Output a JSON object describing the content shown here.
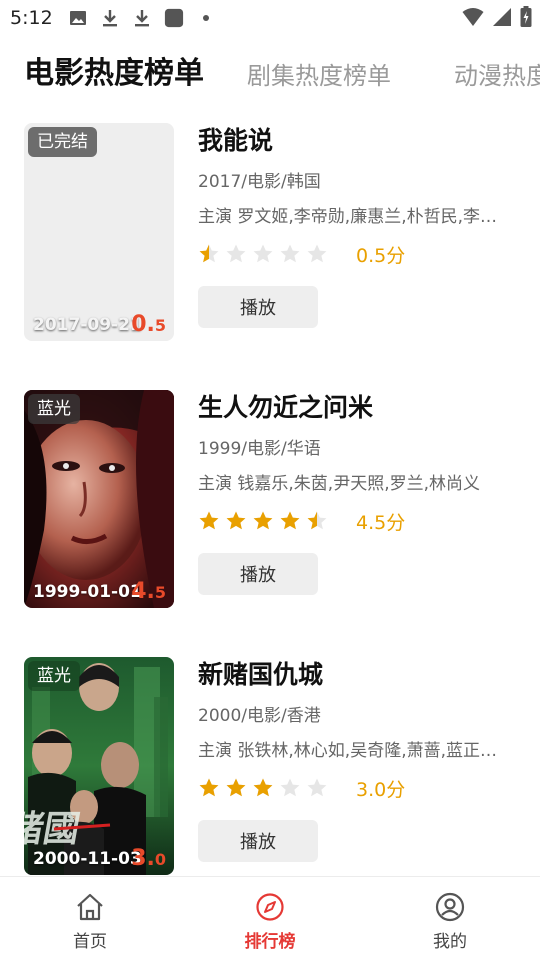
{
  "status_bar": {
    "time": "5:12",
    "left_icons": [
      "image-icon",
      "download-icon",
      "download-icon",
      "app-square-icon",
      "dot-icon"
    ],
    "right_icons": [
      "wifi-icon",
      "cellular-icon",
      "battery-icon"
    ]
  },
  "tabs": [
    {
      "label": "电影热度榜单",
      "active": true
    },
    {
      "label": "剧集热度榜单",
      "active": false
    },
    {
      "label": "动漫热度榜单",
      "active": false
    }
  ],
  "movies": [
    {
      "title": "我能说",
      "meta": "2017/电影/韩国",
      "cast": "主演 罗文姬,李帝勋,廉惠兰,朴哲民,李…",
      "stars": 0.5,
      "rating_text": "0.5分",
      "play_label": "播放",
      "badge": "已完结",
      "poster_date": "2017-09-21",
      "poster_score_main": "0.",
      "poster_score_small": "5",
      "poster_style": "blank"
    },
    {
      "title": "生人勿近之问米",
      "meta": "1999/电影/华语",
      "cast": "主演 钱嘉乐,朱茵,尹天照,罗兰,林尚义",
      "stars": 4.5,
      "rating_text": "4.5分",
      "play_label": "播放",
      "badge": "蓝光",
      "poster_date": "1999-01-01",
      "poster_score_main": "4.",
      "poster_score_small": "5",
      "poster_style": "red-face"
    },
    {
      "title": "新赌国仇城",
      "meta": "2000/电影/香港",
      "cast": "主演 张铁林,林心如,吴奇隆,萧蔷,蓝正…",
      "stars": 3.0,
      "rating_text": "3.0分",
      "play_label": "播放",
      "badge": "蓝光",
      "poster_date": "2000-11-03",
      "poster_score_main": "3.",
      "poster_score_small": "0",
      "poster_style": "green-city"
    }
  ],
  "bottom_nav": [
    {
      "label": "首页",
      "icon": "home-icon",
      "active": false
    },
    {
      "label": "排行榜",
      "icon": "compass-icon",
      "active": true
    },
    {
      "label": "我的",
      "icon": "user-icon",
      "active": false
    }
  ],
  "colors": {
    "accent": "#e53935",
    "star": "#e9a000",
    "star_empty": "#e6e6e6",
    "poster_score": "#e84a2a"
  }
}
